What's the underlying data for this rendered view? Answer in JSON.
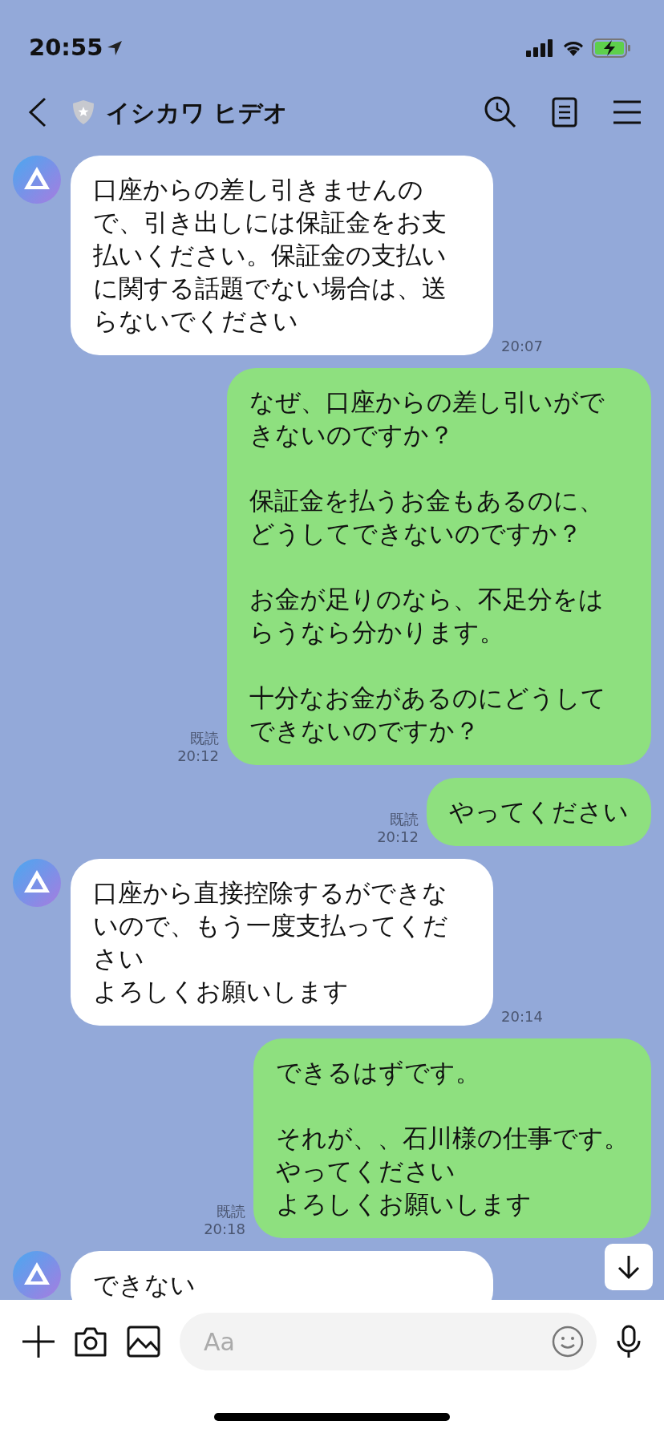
{
  "status_bar": {
    "time": "20:55"
  },
  "header": {
    "title": "イシカワ ヒデオ"
  },
  "messages": [
    {
      "kind": "incoming",
      "paragraphs": [
        [
          "口座からの差し引きませんので、引き出しには保証金をお支払いください。保証金の支払いに関する話題でない場合は、送らないでください"
        ]
      ],
      "time": "20:07"
    },
    {
      "kind": "outgoing",
      "paragraphs": [
        [
          "なぜ、口座からの差し引いができないのですか？"
        ],
        [
          "保証金を払うお金もあるのに、どうしてできないのですか？"
        ],
        [
          "お金が足りのなら、不足分をはらうなら分かります。"
        ],
        [
          "十分なお金があるのにどうしてできないのですか？"
        ]
      ],
      "time": "20:12",
      "read_label": "既読"
    },
    {
      "kind": "outgoing",
      "paragraphs": [
        [
          "やってください"
        ]
      ],
      "time": "20:12",
      "read_label": "既読"
    },
    {
      "kind": "incoming",
      "paragraphs": [
        [
          "口座から直接控除するができないので、もう一度支払ってください",
          "よろしくお願いします"
        ]
      ],
      "time": "20:14"
    },
    {
      "kind": "outgoing",
      "paragraphs": [
        [
          "できるはずです。"
        ],
        [
          "それが、、石川様の仕事です。",
          "やってください",
          "よろしくお願いします"
        ]
      ],
      "time": "20:18",
      "read_label": "既読"
    },
    {
      "kind": "incoming",
      "paragraphs": [
        [
          "できない"
        ]
      ]
    }
  ],
  "input": {
    "placeholder": "Aa"
  }
}
